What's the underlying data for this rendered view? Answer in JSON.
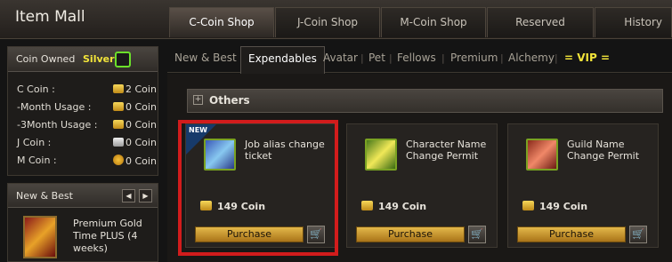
{
  "app": {
    "title": "Item Mall"
  },
  "tabs": [
    {
      "label": "C-Coin Shop",
      "active": true
    },
    {
      "label": "J-Coin Shop",
      "active": false
    },
    {
      "label": "M-Coin Shop",
      "active": false
    },
    {
      "label": "Reserved",
      "active": false
    },
    {
      "label": "History",
      "active": false
    }
  ],
  "coins": {
    "heading": "Coin Owned",
    "level": "Silver",
    "rows": [
      {
        "label": "C Coin :",
        "value": "2 Coin"
      },
      {
        "label": "-Month Usage :",
        "value": "0 Coin"
      },
      {
        "label": "-3Month Usage :",
        "value": "0 Coin"
      },
      {
        "label": "J Coin :",
        "value": "0 Coin"
      },
      {
        "label": "M Coin :",
        "value": "0 Coin"
      }
    ]
  },
  "new_best": {
    "heading": "New & Best",
    "prev_label": "◀",
    "next_label": "▶",
    "item_name": "Premium Gold Time PLUS (4 weeks)"
  },
  "subnav": {
    "items": [
      "New & Best",
      "Expendables",
      "Avatar",
      "Pet",
      "Fellows",
      "Premium",
      "Alchemy",
      "= VIP ="
    ],
    "active": "Expendables"
  },
  "section": {
    "expand_symbol": "+",
    "title": "Others"
  },
  "products": [
    {
      "name": "Job alias change ticket",
      "price": "149 Coin",
      "button": "Purchase",
      "badge": "NEW",
      "icon": "job-ticket-icon"
    },
    {
      "name": "Character Name Change Permit",
      "price": "149 Coin",
      "button": "Purchase",
      "badge": "",
      "icon": "name-permit-icon"
    },
    {
      "name": "Guild Name Change Permit",
      "price": "149 Coin",
      "button": "Purchase",
      "badge": "",
      "icon": "guild-permit-icon"
    }
  ],
  "cart_symbol": "🛒",
  "colors": {
    "highlight_frame": "#d21c1c",
    "vip": "#f2e43a",
    "level": "#f2e43a",
    "purchase_button": "#d9a83a"
  }
}
